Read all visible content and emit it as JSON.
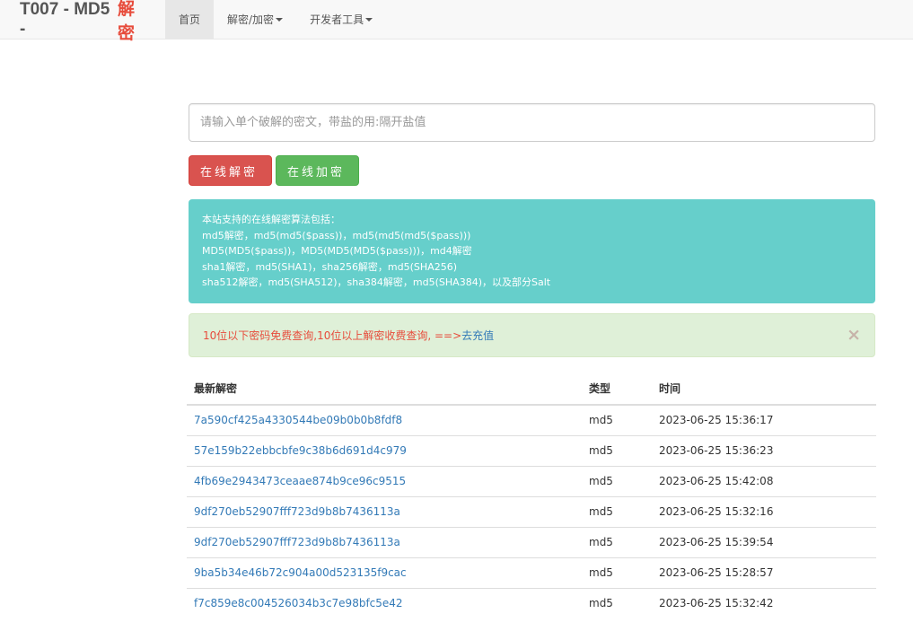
{
  "navbar": {
    "brand_prefix": "T007 - MD5 - ",
    "brand_accent": "解密",
    "home": "首页",
    "decrypt_menu": "解密/加密",
    "dev_tools": "开发者工具"
  },
  "search": {
    "placeholder": "请输入单个破解的密文，带盐的用:隔开盐值"
  },
  "buttons": {
    "decrypt": "在线解密",
    "encrypt": "在线加密"
  },
  "info": {
    "lines": [
      "本站支持的在线解密算法包括：",
      "md5解密，md5(md5($pass))，md5(md5(md5($pass)))",
      "MD5(MD5($pass))，MD5(MD5(MD5($pass)))，md4解密",
      "sha1解密，md5(SHA1)，sha256解密，md5(SHA256)",
      "sha512解密，md5(SHA512)，sha384解密，md5(SHA384)，以及部分Salt"
    ]
  },
  "notice": {
    "text": "10位以下密码免费查询,10位以上解密收费查询, ==>",
    "link": "去充值",
    "close": "×"
  },
  "table": {
    "headers": [
      "最新解密",
      "类型",
      "时间"
    ],
    "rows": [
      [
        "7a590cf425a4330544be09b0b0b8fdf8",
        "md5",
        "2023-06-25 15:36:17"
      ],
      [
        "57e159b22ebbcbfe9c38b6d691d4c979",
        "md5",
        "2023-06-25 15:36:23"
      ],
      [
        "4fb69e2943473ceaae874b9ce96c9515",
        "md5",
        "2023-06-25 15:42:08"
      ],
      [
        "9df270eb52907fff723d9b8b7436113a",
        "md5",
        "2023-06-25 15:32:16"
      ],
      [
        "9df270eb52907fff723d9b8b7436113a",
        "md5",
        "2023-06-25 15:39:54"
      ],
      [
        "9ba5b34e46b72c904a00d523135f9cac",
        "md5",
        "2023-06-25 15:28:57"
      ],
      [
        "f7c859e8c004526034b3c7e98bfc5e42",
        "md5",
        "2023-06-25 15:32:42"
      ]
    ]
  },
  "colors": {
    "brand_accent": "#e74c3c",
    "decrypt_btn": "#d9534f",
    "encrypt_btn": "#5cb85c",
    "info_bg": "#66cfcb",
    "notice_bg": "#dff0d8",
    "link": "#337ab7"
  }
}
